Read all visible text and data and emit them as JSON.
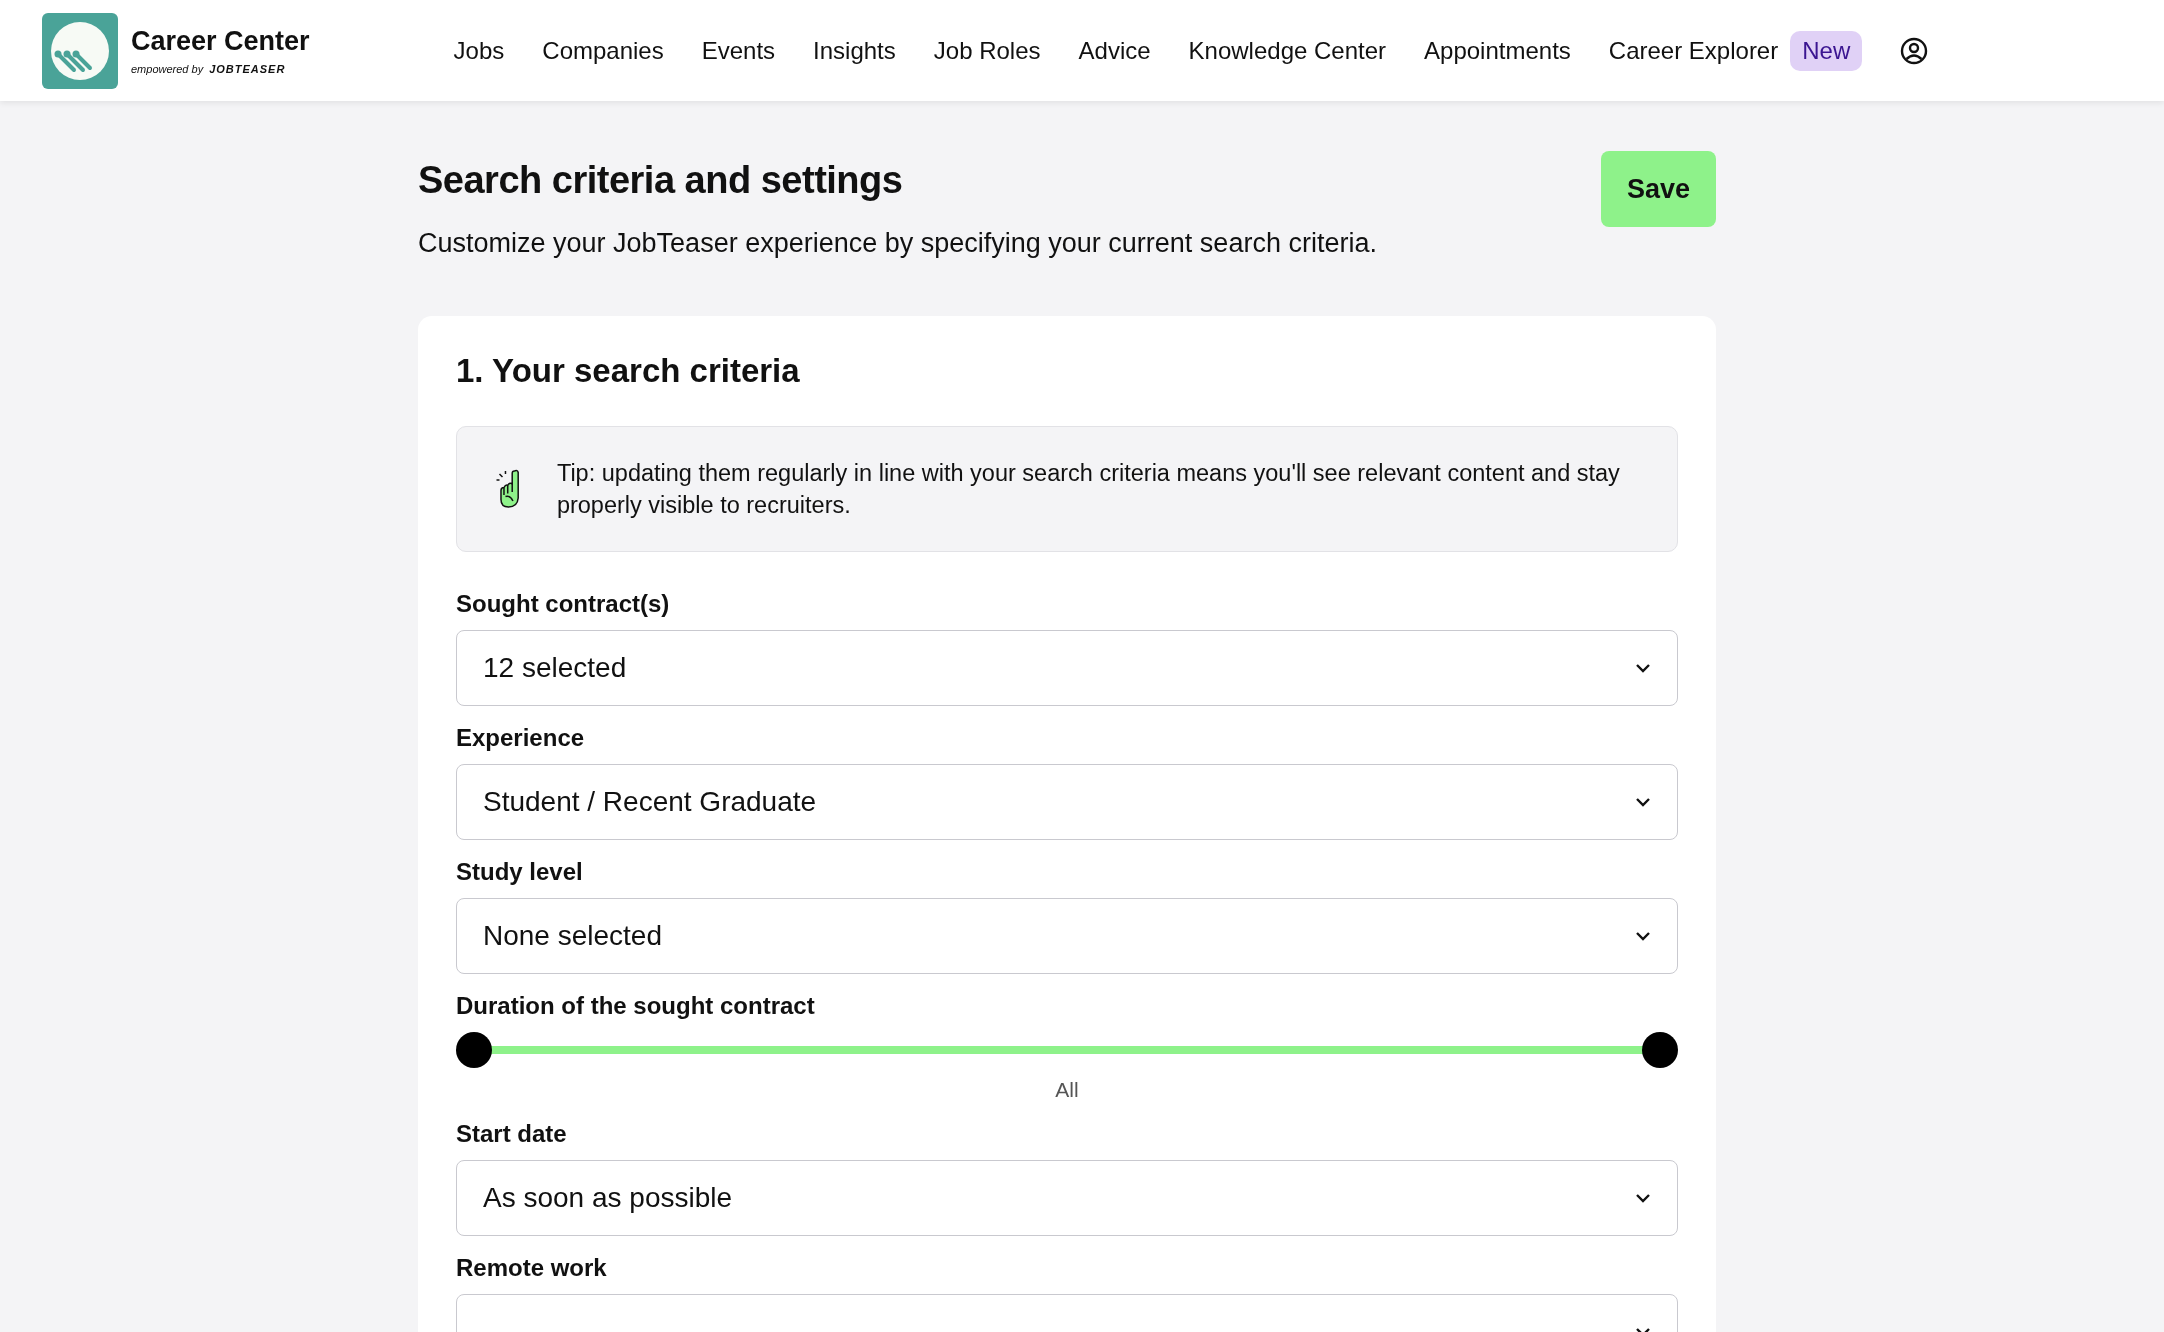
{
  "header": {
    "brand": {
      "title": "Career Center",
      "subtitle": "empowered by",
      "partner": "JOBTEASER"
    },
    "nav": [
      {
        "label": "Jobs",
        "selected": false
      },
      {
        "label": "Companies",
        "selected": false
      },
      {
        "label": "Events",
        "selected": false
      },
      {
        "label": "Insights",
        "selected": false
      },
      {
        "label": "Job Roles",
        "selected": false
      },
      {
        "label": "Advice",
        "selected": false
      },
      {
        "label": "Knowledge Center",
        "selected": false
      },
      {
        "label": "Appointments",
        "selected": false
      },
      {
        "label": "Career Explorer",
        "selected": false,
        "badge": "New"
      }
    ]
  },
  "page": {
    "title": "Search criteria and settings",
    "save_button": "Save",
    "subtitle": "Customize your JobTeaser experience by specifying your current search criteria."
  },
  "section": {
    "title": "1. Your search criteria",
    "tip": "Tip: updating them regularly in line with your search criteria means you'll see relevant content and stay properly visible to recruiters.",
    "fields": [
      {
        "kind": "select",
        "label": "Sought contract(s)",
        "value": "12 selected"
      },
      {
        "kind": "select",
        "label": "Experience",
        "value": "Student / Recent Graduate"
      },
      {
        "kind": "select",
        "label": "Study level",
        "value": "None selected"
      },
      {
        "kind": "range",
        "label": "Duration of the sought contract",
        "thumbs": [
          {
            "level": 0
          },
          {
            "level": 1
          }
        ],
        "reading": "All"
      },
      {
        "kind": "select",
        "label": "Start date",
        "value": "As soon as possible"
      },
      {
        "kind": "select",
        "label": "Remote work"
      }
    ]
  }
}
